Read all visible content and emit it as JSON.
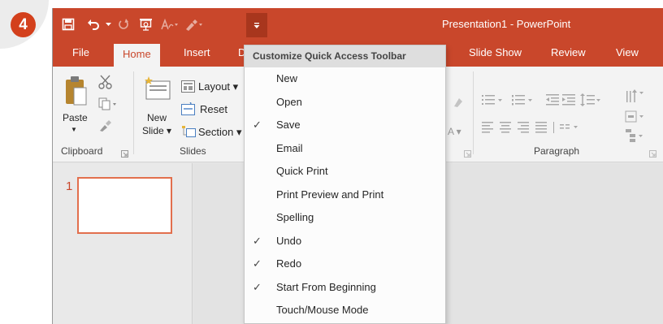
{
  "step_badge": "4",
  "window": {
    "title": "Presentation1 - PowerPoint"
  },
  "colors": {
    "accent": "#c9472b",
    "accent_dark": "#a8361d",
    "badge": "#d3401c"
  },
  "quick_access_toolbar": {
    "icons": [
      "save-icon",
      "undo-icon",
      "undo-dropdown-icon",
      "redo-icon",
      "start-from-beginning-icon",
      "touch-mode-icon",
      "format-painter-icon",
      "customize-qat-icon"
    ]
  },
  "tabs": {
    "file": "File",
    "home": "Home",
    "insert": "Insert",
    "design_partial": "D",
    "slide_show": "Slide Show",
    "review": "Review",
    "view": "View"
  },
  "ribbon": {
    "paste": "Paste",
    "new_slide_line1": "New",
    "new_slide_line2": "Slide ▾",
    "layout": "Layout ▾",
    "reset": "Reset",
    "section": "Section ▾",
    "groups": {
      "clipboard": "Clipboard",
      "slides": "Slides",
      "paragraph": "Paragraph"
    }
  },
  "thumbnails": {
    "slide_number": "1"
  },
  "menu": {
    "header": "Customize Quick Access Toolbar",
    "items": [
      {
        "label": "New",
        "checked": false
      },
      {
        "label": "Open",
        "checked": false
      },
      {
        "label": "Save",
        "checked": true
      },
      {
        "label": "Email",
        "checked": false
      },
      {
        "label": "Quick Print",
        "checked": false
      },
      {
        "label": "Print Preview and Print",
        "checked": false
      },
      {
        "label": "Spelling",
        "checked": false
      },
      {
        "label": "Undo",
        "checked": true
      },
      {
        "label": "Redo",
        "checked": true
      },
      {
        "label": "Start From Beginning",
        "checked": true
      },
      {
        "label": "Touch/Mouse Mode",
        "checked": false
      }
    ],
    "check_glyph": "✓"
  }
}
